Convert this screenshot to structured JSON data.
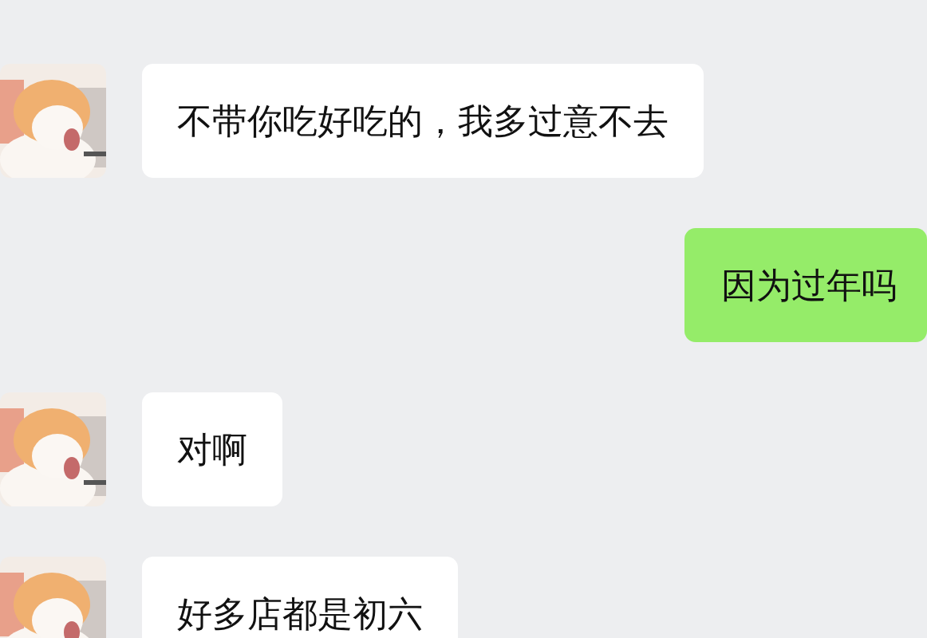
{
  "messages": [
    {
      "kind": "received",
      "text": "不带你吃好吃的，我多过意不去"
    },
    {
      "kind": "sent",
      "text": "因为过年吗"
    },
    {
      "kind": "received",
      "text": "对啊"
    },
    {
      "kind": "received",
      "text": "好多店都是初六"
    }
  ]
}
